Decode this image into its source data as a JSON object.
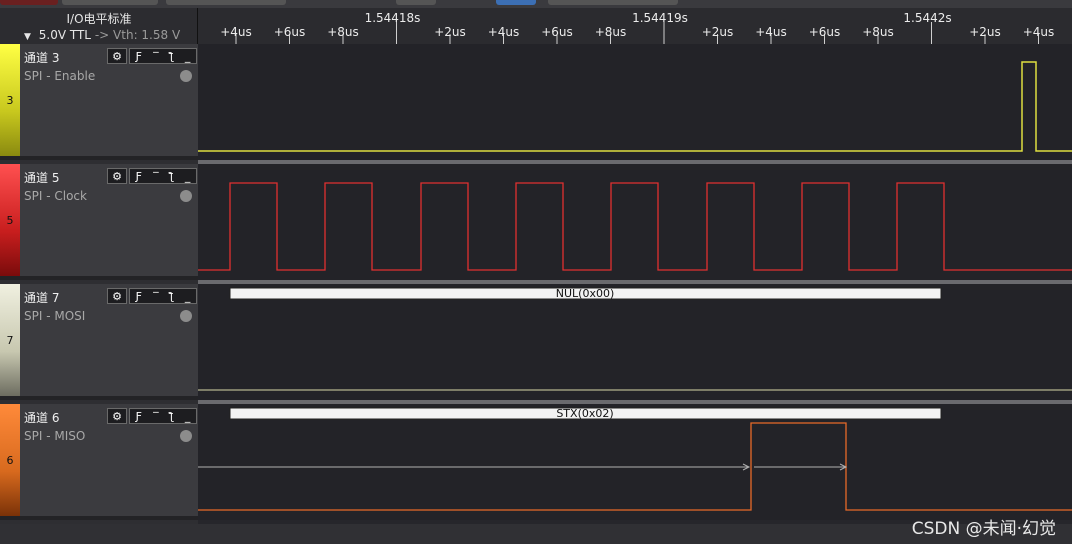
{
  "header": {
    "io_standard": "I/O电平标准",
    "voltage": "5.0V TTL",
    "arrow": "->",
    "vth": "Vth: 1.58 V"
  },
  "timeline": {
    "ticks": [
      {
        "label": "+4us",
        "major": false
      },
      {
        "label": "+6us",
        "major": false
      },
      {
        "label": "+8us",
        "major": false
      },
      {
        "label": "1.54418s",
        "major": true
      },
      {
        "label": "+2us",
        "major": false
      },
      {
        "label": "+4us",
        "major": false
      },
      {
        "label": "+6us",
        "major": false
      },
      {
        "label": "+8us",
        "major": false
      },
      {
        "label": "1.54419s",
        "major": true
      },
      {
        "label": "+2us",
        "major": false
      },
      {
        "label": "+4us",
        "major": false
      },
      {
        "label": "+6us",
        "major": false
      },
      {
        "label": "+8us",
        "major": false
      },
      {
        "label": "1.5442s",
        "major": true
      },
      {
        "label": "+2us",
        "major": false
      },
      {
        "label": "+4us",
        "major": false
      }
    ]
  },
  "channels": [
    {
      "num": "3",
      "name": "通道 3",
      "sub": "SPI - Enable",
      "color": "#c8c81e",
      "stripe_top": "#ffff44",
      "stripe_bot": "#8a8a10",
      "wave": "#e0e040"
    },
    {
      "num": "5",
      "name": "通道 5",
      "sub": "SPI - Clock",
      "color": "#c81e1e",
      "stripe_top": "#ff5050",
      "stripe_bot": "#7a0c0c",
      "wave": "#e03030"
    },
    {
      "num": "7",
      "name": "通道 7",
      "sub": "SPI - MOSI",
      "color": "#c8c8b0",
      "stripe_top": "#f0f0e0",
      "stripe_bot": "#6c6c60",
      "wave": "#d8d8a8",
      "decode": "NUL(0x00)"
    },
    {
      "num": "6",
      "name": "通道 6",
      "sub": "SPI - MISO",
      "color": "#d86a1e",
      "stripe_top": "#ff8a3a",
      "stripe_bot": "#7a3208",
      "wave": "#e86a28",
      "decode": "STX(0x02)"
    }
  ],
  "buttons": {
    "gear": "⚙",
    "rise": "Ƒ",
    "high": "‾",
    "fall": "ƪ",
    "low": "_"
  },
  "watermark": "CSDN @未闻·幻觉"
}
